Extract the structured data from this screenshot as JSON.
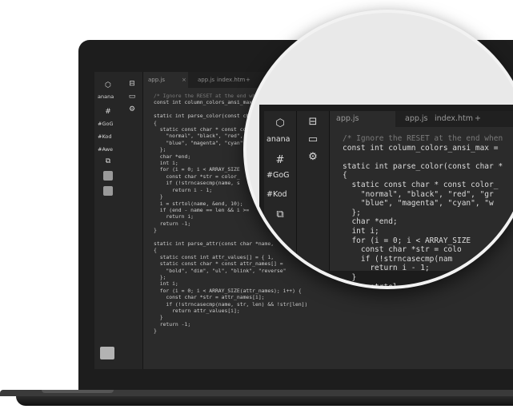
{
  "tabs": [
    {
      "label": "app.js"
    },
    {
      "label": "app.js"
    },
    {
      "label": "index.htm"
    },
    {
      "label": "+"
    }
  ],
  "sidebar": {
    "items": [
      {
        "icon": "cube-icon",
        "label": "anana"
      },
      {
        "icon": "hash-icon",
        "label": "#GoG"
      },
      {
        "label": "#Kod"
      },
      {
        "label": "#Awe"
      }
    ]
  },
  "code_lines_small": [
    "/* Ignore the RESET at the end wh",
    "const int column_colors_ansi_max",
    "",
    "static int parse_color(const char",
    "{",
    "  static const char * const colo",
    "    \"normal\", \"black\", \"red\",",
    "    \"blue\", \"magenta\", \"cyan\",",
    "  };",
    "  char *end;",
    "  int i;",
    "  for (i = 0; i < ARRAY_SIZE",
    "    const char *str = color_",
    "    if (!strncasecmp(name, s",
    "      return i - 1;",
    "  }",
    "  i = strtol(name, &end, 10);",
    "  if (end - name == len && i >=",
    "    return i;",
    "  return -1;",
    "}",
    "",
    "static int parse_attr(const char *name,",
    "{",
    "  static const int attr_values[] = { 1,",
    "  static const char * const attr_names[] =",
    "    \"bold\", \"dim\", \"ul\", \"blink\", \"reverse\"",
    "  };",
    "  int i;",
    "  for (i = 0; i < ARRAY_SIZE(attr_names); i++) {",
    "    const char *str = attr_names[i];",
    "    if (!strncasecmp(name, str, len) && !str[len])",
    "      return attr_values[i];",
    "  }",
    "  return -1;",
    "}"
  ],
  "code_lines_lens": [
    "/* Ignore the RESET at the end when",
    "const int column_colors_ansi_max =",
    "",
    "static int parse_color(const char *",
    "{",
    "  static const char * const color_",
    "    \"normal\", \"black\", \"red\", \"gr",
    "    \"blue\", \"magenta\", \"cyan\", \"w",
    "  };",
    "  char *end;",
    "  int i;",
    "  for (i = 0; i < ARRAY_SIZE",
    "    const char *str = colo",
    "    if (!strncasecmp(nam",
    "      return i - 1;",
    "  }",
    "  i = strtol"
  ]
}
